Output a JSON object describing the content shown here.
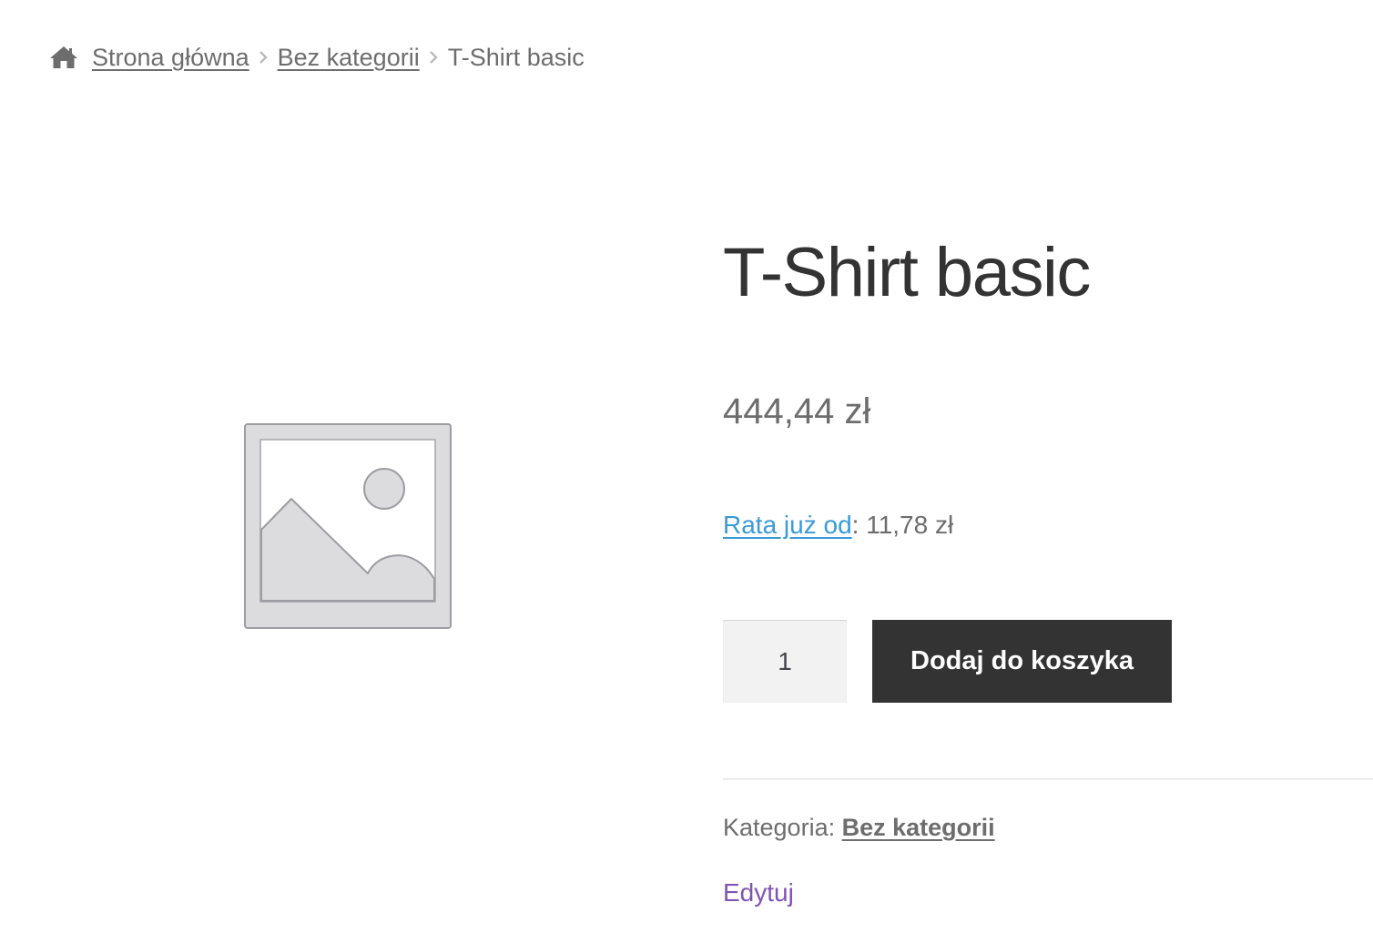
{
  "breadcrumb": {
    "home_label": "Strona główna",
    "category_label": "Bez kategorii",
    "current_label": "T-Shirt basic",
    "home_icon": "home-icon",
    "separator_icon": "chevron-right-icon"
  },
  "product": {
    "image_icon": "image-placeholder-icon",
    "title": "T-Shirt basic",
    "price": "444,44 zł",
    "installment": {
      "link_label": "Rata już od",
      "separator": ":",
      "amount": " 11,78 zł"
    },
    "quantity": "1",
    "add_to_cart_label": "Dodaj do koszyka",
    "meta": {
      "category_prefix": "Kategoria: ",
      "category_value": "Bez kategorii"
    },
    "edit_label": "Edytuj"
  },
  "colors": {
    "text": "#6d6d6d",
    "heading": "#333333",
    "button_bg": "#333333",
    "link_blue": "#3a9ad9",
    "edit_purple": "#7f54b3",
    "qty_bg": "#f2f2f2"
  }
}
